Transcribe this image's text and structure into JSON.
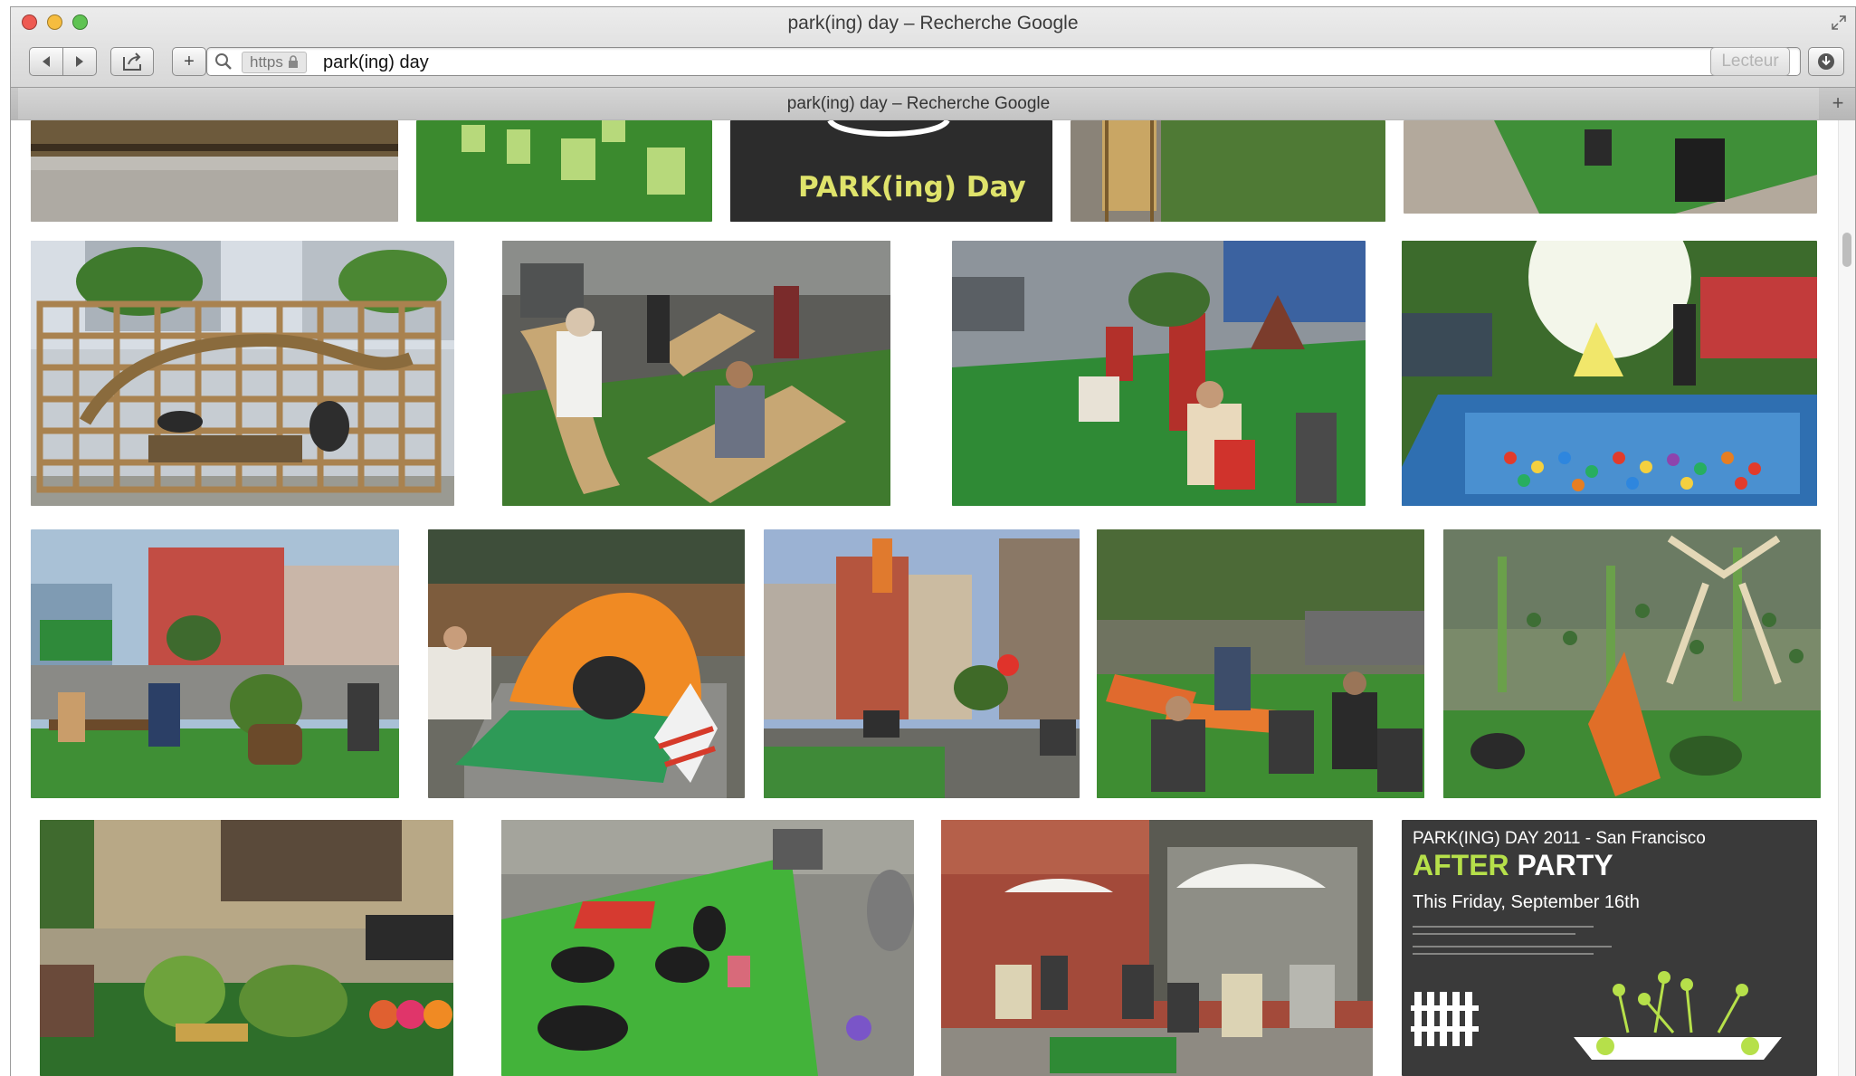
{
  "window": {
    "title": "park(ing) day – Recherche Google",
    "tab_title": "park(ing) day – Recherche Google"
  },
  "toolbar": {
    "back_icon": "back-arrow-icon",
    "forward_icon": "forward-arrow-icon",
    "share_icon": "share-icon",
    "plus_label": "+",
    "protocol": "https",
    "url": "park(ing) day",
    "reader_label": "Lecteur",
    "new_tab_label": "+"
  },
  "results": {
    "images": [
      {
        "row": 1,
        "subject": "cardboard lounge, partial"
      },
      {
        "row": 1,
        "subject": "green bags on turf, partial"
      },
      {
        "row": 1,
        "subject": "PARK(ing) Day logo",
        "logo_text": "PARK(ing) Day"
      },
      {
        "row": 1,
        "subject": "bench and plants, partial"
      },
      {
        "row": 1,
        "subject": "people on turf, partial"
      },
      {
        "row": 2,
        "subject": "cardboard grid structure"
      },
      {
        "row": 2,
        "subject": "people on cardboard loungers"
      },
      {
        "row": 2,
        "subject": "turf with red chairs"
      },
      {
        "row": 2,
        "subject": "ball pit"
      },
      {
        "row": 3,
        "subject": "street parklet with plants"
      },
      {
        "row": 3,
        "subject": "orange tent"
      },
      {
        "row": 3,
        "subject": "european street parklet"
      },
      {
        "row": 3,
        "subject": "people sitting on grass"
      },
      {
        "row": 3,
        "subject": "hanging plants and sign"
      },
      {
        "row": 4,
        "subject": "planted parklet with benches"
      },
      {
        "row": 4,
        "subject": "yoga on turf"
      },
      {
        "row": 4,
        "subject": "cafe with umbrellas"
      },
      {
        "row": 4,
        "subject": "after party poster",
        "poster": {
          "line1": "PARK(ING) DAY 2011 - San Francisco",
          "after": "AFTER",
          "party": "PARTY",
          "date": "This Friday, September 16th"
        }
      }
    ]
  },
  "colors": {
    "chrome_top": "#ececec",
    "chrome_bottom": "#cfcfcf",
    "turf_green": "#3f9a3a",
    "poster_bg": "#3a3a3a",
    "poster_green": "#b6e04a"
  }
}
